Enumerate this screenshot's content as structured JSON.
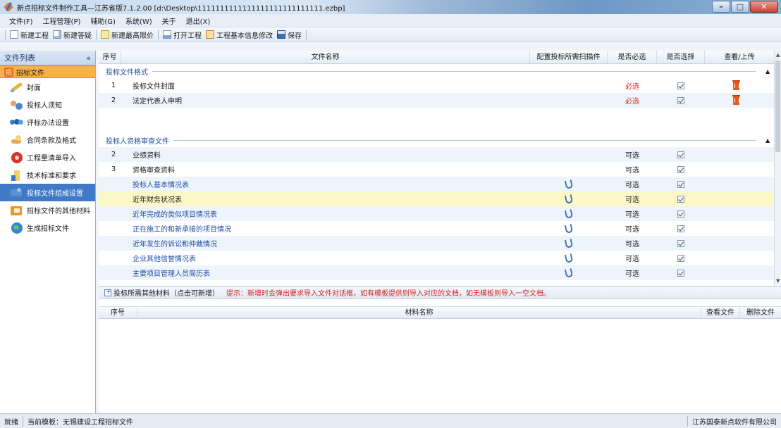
{
  "window": {
    "title": "新点招标文件制作工具—江苏省版7.1.2.00    [d:\\Desktop\\1111111111111111111111111111.ezbp]",
    "min": "–",
    "max": "□",
    "close": "✕"
  },
  "menu": [
    "文件(F)",
    "工程管理(P)",
    "辅助(G)",
    "系统(W)",
    "关于",
    "退出(X)"
  ],
  "toolbar": {
    "new_project": "新建工程",
    "new_qa": "新建答疑",
    "new_max_price": "新建最高限价",
    "open_project": "打开工程",
    "edit_info": "工程基本信息修改",
    "save": "保存"
  },
  "sidebar": {
    "title": "文件列表",
    "collapse": "«",
    "first_tag": "招",
    "items": [
      {
        "label": "招标文件"
      },
      {
        "label": "封面"
      },
      {
        "label": "投标人须知"
      },
      {
        "label": "评标办法设置"
      },
      {
        "label": "合同条款及格式"
      },
      {
        "label": "工程量清单导入"
      },
      {
        "label": "技术标准和要求"
      },
      {
        "label": "投标文件组成设置"
      },
      {
        "label": "招标文件的其他材料"
      },
      {
        "label": "生成招标文件"
      }
    ]
  },
  "grid": {
    "headers": {
      "no": "序号",
      "name": "文件名称",
      "scan": "配置投标所需扫描件",
      "must": "是否必选",
      "select": "是否选择",
      "view": "查看/上传"
    },
    "group1": {
      "title": "投标文件格式",
      "rows": [
        {
          "no": "1",
          "name": "投标文件封面",
          "must": "必选"
        },
        {
          "no": "2",
          "name": "法定代表人申明",
          "must": "必选"
        }
      ]
    },
    "group2": {
      "title": "投标人资格审查文件",
      "rows": [
        {
          "no": "2",
          "name": "业绩资料",
          "must": "可选"
        },
        {
          "no": "3",
          "name": "资格审查资料",
          "must": "可选"
        },
        {
          "no": "",
          "name": "投标人基本情况表",
          "must": "可选"
        },
        {
          "no": "",
          "name": "近年财务状况表",
          "must": "可选"
        },
        {
          "no": "",
          "name": "近年完成的类似项目情况表",
          "must": "可选"
        },
        {
          "no": "",
          "name": "正在施工的和新承接的项目情况",
          "must": "可选"
        },
        {
          "no": "",
          "name": "近年发生的诉讼和仲裁情况",
          "must": "可选"
        },
        {
          "no": "",
          "name": "企业其他信誉情况表",
          "must": "可选"
        },
        {
          "no": "",
          "name": "主要项目管理人员简历表",
          "must": "可选"
        }
      ]
    }
  },
  "lower": {
    "add_button": "投标所需其他材料（点击可新增）",
    "hint": "提示：新增时会弹出要求导入文件对话框，如有模板提供则导入对应的文档，如无模板则导入一空文档。",
    "headers": {
      "no": "序号",
      "name": "材料名称",
      "view": "查看文件",
      "delete": "删除文件"
    }
  },
  "status": {
    "ready": "就绪",
    "template": "当前模板：无锡建设工程招标文件",
    "company": "江苏国泰新点软件有限公司"
  }
}
